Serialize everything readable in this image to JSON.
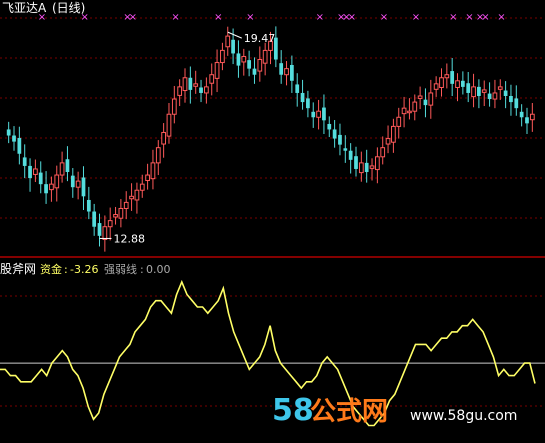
{
  "top_panel": {
    "title": "飞亚达A",
    "period": "(日线)",
    "high_label": "19.47",
    "low_label": "12.88",
    "signal_marker": "×",
    "signal_color": "#ff55ff"
  },
  "bottom_panel": {
    "indicator_name": "股斧网",
    "series": [
      {
        "name": "资金",
        "value": "-3.26",
        "color": "#ffff66"
      },
      {
        "name": "强弱线",
        "value": "0.00",
        "color": "#cccccc"
      }
    ]
  },
  "watermark": {
    "brand_num": "58",
    "brand_text": "公式网",
    "url": "www.58gu.com"
  },
  "colors": {
    "up": "#ff5a5a",
    "down": "#55dddd",
    "grid": "#7a0000",
    "separator": "#b00000",
    "text": "#ffffff",
    "label_yellow": "#ffff66",
    "label_gray": "#aaaaaa"
  },
  "chart_data": [
    {
      "type": "candlestick",
      "price_range": [
        12.5,
        20.0
      ],
      "prices": [
        16.2,
        16.0,
        15.6,
        15.2,
        14.8,
        15.1,
        14.6,
        14.3,
        14.6,
        14.9,
        15.3,
        15.0,
        14.5,
        14.7,
        14.2,
        13.7,
        13.2,
        12.9,
        13.2,
        13.4,
        13.6,
        13.8,
        14.0,
        14.2,
        14.4,
        14.6,
        14.9,
        15.3,
        15.8,
        16.3,
        16.9,
        17.4,
        17.8,
        18.1,
        17.7,
        17.9,
        17.6,
        17.8,
        18.2,
        18.6,
        19.0,
        19.47,
        18.9,
        18.5,
        18.8,
        18.4,
        18.2,
        18.7,
        19.0,
        19.3,
        18.7,
        18.2,
        18.4,
        18.0,
        17.6,
        17.3,
        17.1,
        16.8,
        17.0,
        16.7,
        16.4,
        16.1,
        15.9,
        15.7,
        15.4,
        15.1,
        15.3,
        15.0,
        15.2,
        15.5,
        15.8,
        16.1,
        16.5,
        16.8,
        17.1,
        17.0,
        17.3,
        17.5,
        17.2,
        17.6,
        17.9,
        18.1,
        18.2,
        17.9,
        18.0,
        17.8,
        17.6,
        17.8,
        17.5,
        17.7,
        17.4,
        17.6,
        17.8,
        17.5,
        17.3,
        17.1,
        16.8,
        16.6,
        16.9
      ],
      "high": 19.47,
      "low": 12.88
    },
    {
      "type": "line",
      "series": [
        {
          "name": "资金",
          "values": [
            -1,
            -1,
            -2,
            -2,
            -3,
            -3,
            -3,
            -2,
            -1,
            -2,
            0,
            1,
            2,
            1,
            -1,
            -2,
            -4,
            -7,
            -9,
            -8,
            -5,
            -3,
            -1,
            1,
            2,
            3,
            5,
            6,
            7,
            9,
            10,
            10,
            9,
            8,
            11,
            13,
            11,
            10,
            9,
            9,
            8,
            9,
            10,
            12,
            8,
            5,
            3,
            1,
            -1,
            0,
            1,
            3,
            6,
            2,
            0,
            -1,
            -2,
            -3,
            -4,
            -3,
            -3,
            -2,
            0,
            1,
            0,
            -1,
            -3,
            -5,
            -7,
            -8,
            -9,
            -10,
            -10,
            -9,
            -8,
            -6,
            -5,
            -3,
            -1,
            1,
            3,
            3,
            3,
            2,
            3,
            4,
            4,
            5,
            5,
            6,
            6,
            7,
            6,
            5,
            3,
            1,
            -2,
            -1,
            -2,
            -2,
            -1,
            0,
            0,
            -3.26
          ]
        },
        {
          "name": "强弱线",
          "values": [
            0
          ]
        }
      ],
      "ylim": [
        -12,
        13
      ]
    }
  ]
}
